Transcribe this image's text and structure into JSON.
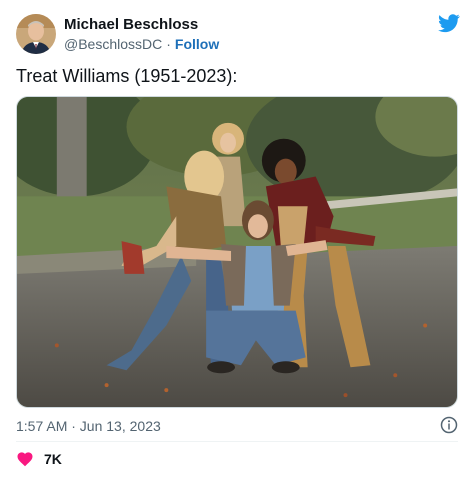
{
  "author": {
    "display_name": "Michael Beschloss",
    "handle": "@BeschlossDC",
    "separator": "·",
    "follow_label": "Follow"
  },
  "tweet": {
    "text": "Treat Williams (1951-2023):",
    "timestamp": "1:57 AM · Jun 13, 2023"
  },
  "engagement": {
    "likes": "7K"
  },
  "icons": {
    "platform": "bird-icon",
    "info": "info-icon",
    "like": "heart-icon"
  },
  "colors": {
    "brand": "#1d9bf0",
    "follow": "#1d6fb8",
    "heart": "#f91880",
    "secondary_text": "#536471"
  }
}
